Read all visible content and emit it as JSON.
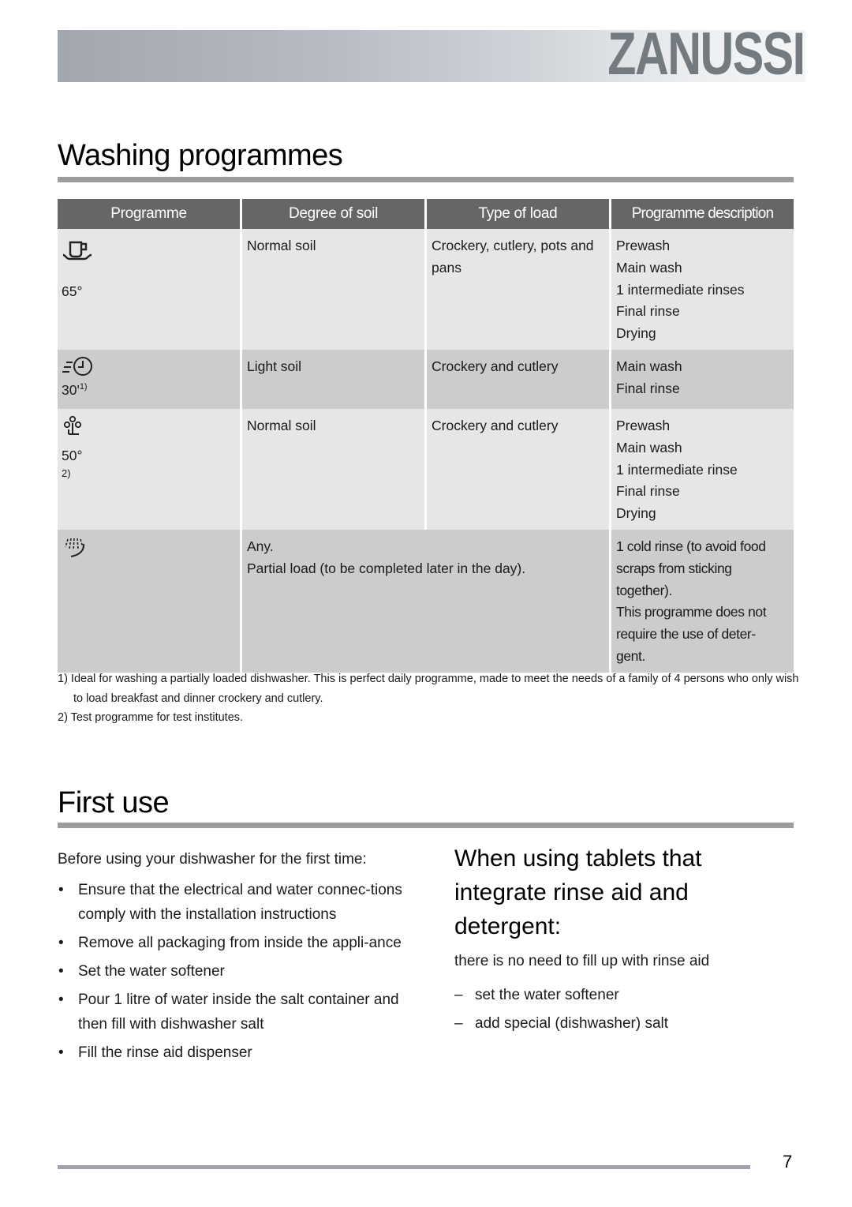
{
  "header": {
    "brand": "ZANUSSI"
  },
  "washing": {
    "title": "Washing programmes",
    "columns": [
      "Programme",
      "Degree of soil",
      "Type of load",
      "Programme description"
    ],
    "rows": [
      {
        "icon": "cup-saucer-icon",
        "temperature": "65°",
        "temp_superscript": "",
        "note": "",
        "soil": "Normal soil",
        "load": "Crockery, cutlery, pots and pans",
        "description": [
          "Prewash",
          "Main wash",
          "1 intermediate rinses",
          "Final rinse",
          "Drying"
        ]
      },
      {
        "icon": "quick-clock-icon",
        "temperature": "30'",
        "temp_superscript": "1)",
        "note": "",
        "soil": "Light soil",
        "load": "Crockery and cutlery",
        "description": [
          "Main wash",
          "Final rinse"
        ]
      },
      {
        "icon": "eco-plant-icon",
        "temperature": "50°",
        "temp_superscript": "",
        "note": "2)",
        "soil": "Normal soil",
        "load": "Crockery and cutlery",
        "description": [
          "Prewash",
          "Main wash",
          "1 intermediate rinse",
          "Final rinse",
          "Drying"
        ]
      },
      {
        "icon": "rinse-hold-icon",
        "temperature": "",
        "temp_superscript": "",
        "note": "",
        "soil_load": [
          "Any.",
          "Partial load (to be completed later in the day)."
        ],
        "description": [
          "1 cold rinse (to avoid food",
          "scraps from sticking",
          "together).",
          "This programme does not",
          "require the use of deter-",
          "gent."
        ]
      }
    ],
    "footnotes": [
      "1) Ideal for washing a partially loaded dishwasher. This is perfect daily programme, made to meet the needs of a family of 4 persons who only wish to load breakfast and dinner crockery and cutlery.",
      "2) Test programme for test institutes."
    ]
  },
  "first_use": {
    "title": "First use",
    "intro": "Before using your dishwasher for the first time:",
    "steps": [
      "Ensure that the electrical and water connec-tions comply with the installation instructions",
      "Remove all packaging from inside the appli-ance",
      "Set the water softener",
      "Pour 1 litre of water inside the salt container and then fill with dishwasher salt",
      "Fill the rinse aid dispenser"
    ],
    "bullet": "•"
  },
  "tablets": {
    "heading": "When using tablets that integrate rinse aid and detergent:",
    "text": "there is no need to fill up with rinse aid",
    "items": [
      "set the water softener",
      "add special (dishwasher) salt"
    ],
    "dash": "–"
  },
  "footer": {
    "page_number": "7"
  }
}
